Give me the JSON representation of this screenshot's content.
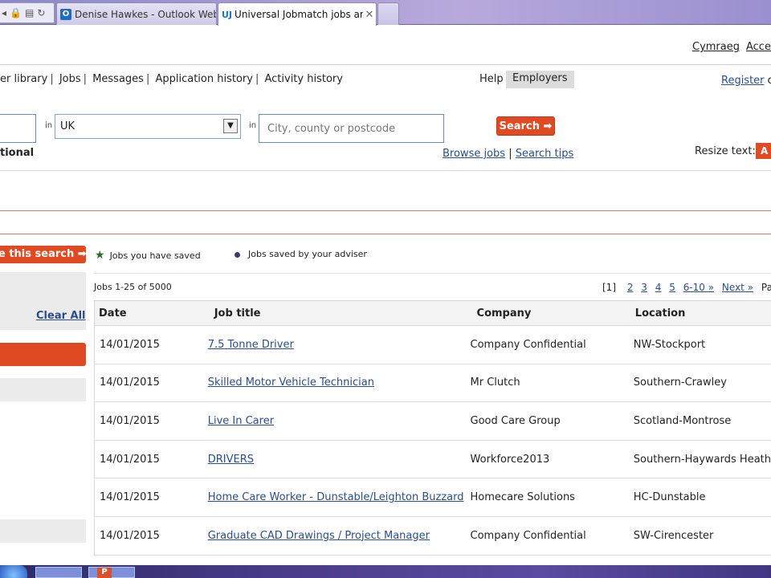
{
  "browser": {
    "tabs": [
      {
        "icon": "outlook-icon",
        "icon_text": "O",
        "title": "Denise Hawkes - Outlook Web ..."
      },
      {
        "icon": "universal-jobmatch-icon",
        "icon_text": "UJ",
        "title": "Universal Jobmatch jobs an..."
      }
    ],
    "tab_close": "✕"
  },
  "header": {
    "language_link": "Cymraeg",
    "accessibility_link": "Acces",
    "nav_items": [
      "er library",
      "Jobs",
      "Messages",
      "Application history",
      "Activity history"
    ],
    "help": "Help",
    "employers": "Employers",
    "register": "Register",
    "register_suffix": "o"
  },
  "search": {
    "in_label": "in",
    "country_value": "UK",
    "location_placeholder": "City, county or postcode",
    "search_button": "Search ➡",
    "optional_label": "tional",
    "browse_jobs": "Browse jobs",
    "search_tips": "Search tips",
    "resize_label": "Resize text:",
    "resize_a": "A"
  },
  "left_panel": {
    "save_search": "e this search ➡",
    "clear_all": "Clear All"
  },
  "legend": {
    "saved_jobs": "Jobs you have saved",
    "adviser_jobs": "Jobs saved by your adviser"
  },
  "results": {
    "count": "Jobs 1-25 of 5000",
    "pager": {
      "current": "[1]",
      "pages": [
        "2",
        "3",
        "4",
        "5",
        "6-10 »",
        "Next »"
      ],
      "trailing": "Page"
    },
    "columns": [
      "Date",
      "Job title",
      "Company",
      "Location"
    ],
    "rows": [
      {
        "date": "14/01/2015",
        "title": "7.5 Tonne Driver",
        "company": "Company Confidential",
        "location": "NW-Stockport"
      },
      {
        "date": "14/01/2015",
        "title": "Skilled Motor Vehicle Technician",
        "company": "Mr Clutch",
        "location": "Southern-Crawley"
      },
      {
        "date": "14/01/2015",
        "title": "Live In Carer",
        "company": "Good Care Group",
        "location": "Scotland-Montrose"
      },
      {
        "date": "14/01/2015",
        "title": "DRIVERS",
        "company": "Workforce2013",
        "location": "Southern-Haywards Heath"
      },
      {
        "date": "14/01/2015",
        "title": "Home Care Worker - Dunstable/Leighton Buzzard",
        "company": "Homecare Solutions",
        "location": "HC-Dunstable"
      },
      {
        "date": "14/01/2015",
        "title": "Graduate CAD Drawings / Project Manager",
        "company": "Company Confidential",
        "location": "SW-Cirencester"
      }
    ]
  },
  "taskbar": {
    "ppt_icon_text": "P"
  },
  "colors": {
    "accent": "#e04a22",
    "link": "#2b4d8c"
  }
}
